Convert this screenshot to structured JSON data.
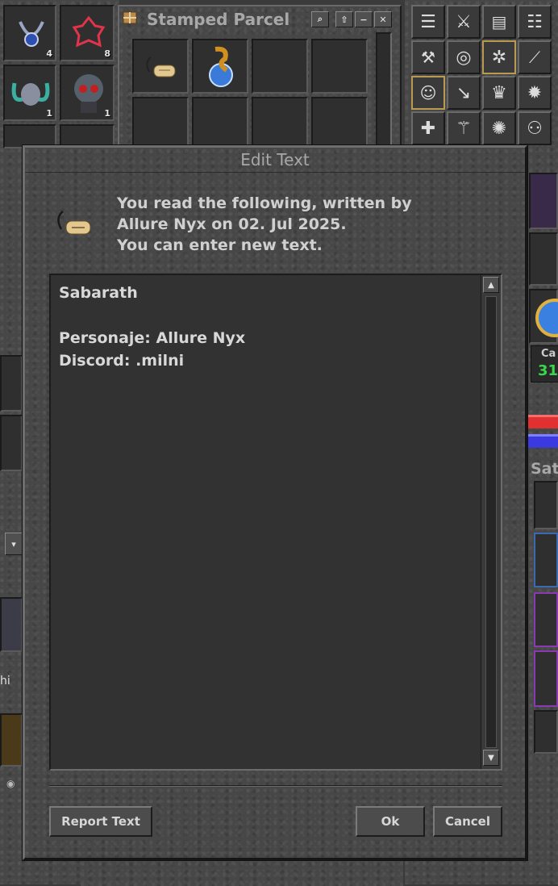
{
  "colors": {
    "dialog_bg": "#474747",
    "text_area_bg": "#323232",
    "text_color": "#d8d8d8",
    "capacity_green": "#3ad64a"
  },
  "left_panel": {
    "slots": [
      {
        "icon": "amulet-icon",
        "count": "4"
      },
      {
        "icon": "red-rune-icon",
        "count": "8"
      },
      {
        "icon": "horned-helmet-icon",
        "count": "1"
      },
      {
        "icon": "demon-skull-icon",
        "count": "1"
      }
    ],
    "partial_label": "hi"
  },
  "parcel": {
    "title": "Stamped Parcel",
    "items": [
      "label-icon",
      "snake-amulet-icon"
    ],
    "buttons": {
      "search": "search-icon",
      "up": "up-arrow-icon",
      "minimize": "minimize-icon",
      "close": "close-icon"
    }
  },
  "right_panel": {
    "capacity_label": "Ca",
    "capacity_value": "31",
    "partial_title": "Sat"
  },
  "dialog": {
    "title": "Edit Text",
    "info_line1": "You read the following, written by",
    "info_line2": "Allure Nyx on 02. Jul 2025.",
    "info_line3": "You can enter new text.",
    "text_value": "Sabarath\n\nPersonaje: Allure Nyx\nDiscord: .milni",
    "report_button": "Report Text",
    "ok_button": "Ok",
    "cancel_button": "Cancel"
  }
}
